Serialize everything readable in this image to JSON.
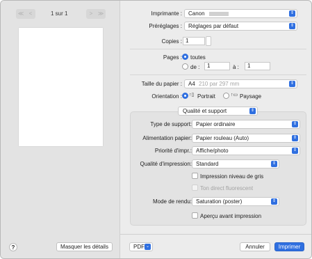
{
  "preview": {
    "first_label": "≪",
    "prev_label": "<",
    "page_indicator": "1 sur 1",
    "next_label": ">",
    "last_label": "≫",
    "help_label": "?",
    "hide_details_label": "Masquer les détails"
  },
  "printer": {
    "label": "Imprimante :",
    "value": "Canon"
  },
  "presets": {
    "label": "Préréglages :",
    "value": "Réglages par défaut"
  },
  "copies": {
    "label": "Copies :",
    "value": "1"
  },
  "pages": {
    "label": "Pages :",
    "all_label": "toutes",
    "from_label": "de :",
    "from_value": "1",
    "to_label": "à :",
    "to_value": "1"
  },
  "paper_size": {
    "label": "Taille du papier :",
    "value": "A4",
    "dimensions": "210 par 297 mm"
  },
  "orientation": {
    "label": "Orientation :",
    "portrait_label": "Portrait",
    "landscape_label": "Paysage"
  },
  "section_menu": {
    "value": "Qualité et support"
  },
  "media_type": {
    "label": "Type de support:",
    "value": "Papier ordinaire"
  },
  "paper_source": {
    "label": "Alimentation papier:",
    "value": "Papier rouleau (Auto)"
  },
  "print_priority": {
    "label": "Priorité d'impr.:",
    "value": "Affiche/photo"
  },
  "print_quality": {
    "label": "Qualité d'impression:",
    "value": "Standard"
  },
  "grayscale": {
    "label": "Impression niveau de gris",
    "checked": false
  },
  "fluorescent": {
    "label": "Ton direct fluorescent",
    "checked": false,
    "enabled": false
  },
  "render_mode": {
    "label": "Mode de rendu:",
    "value": "Saturation (poster)"
  },
  "poster_preview": {
    "label": "Aperçu avant impression",
    "checked": false
  },
  "footer": {
    "pdf_label": "PDF",
    "cancel_label": "Annuler",
    "print_label": "Imprimer"
  },
  "colors": {
    "accent": "#2f6fe0"
  }
}
